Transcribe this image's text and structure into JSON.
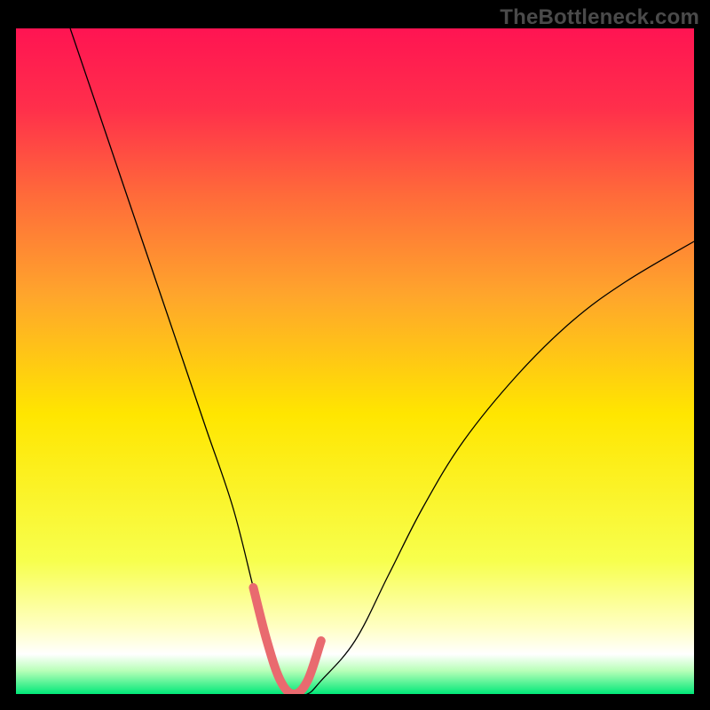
{
  "watermark": "TheBottleneck.com",
  "chart_data": {
    "type": "line",
    "title": "",
    "xlabel": "",
    "ylabel": "",
    "xlim": [
      0,
      100
    ],
    "ylim": [
      0,
      100
    ],
    "background_gradient": {
      "top_color": "#ff1452",
      "mid_color": "#ffe600",
      "bottom_color": "#00e878"
    },
    "series": [
      {
        "name": "bottleneck-curve",
        "x": [
          8,
          12,
          16,
          20,
          24,
          28,
          32,
          35,
          37,
          39,
          41,
          43,
          45,
          50,
          55,
          60,
          66,
          74,
          82,
          90,
          100
        ],
        "y": [
          100,
          88,
          76,
          64,
          52,
          40,
          28,
          16,
          8,
          2,
          0,
          0,
          2,
          8,
          18,
          28,
          38,
          48,
          56,
          62,
          68
        ],
        "stroke": "#000000",
        "stroke_width": 1.3
      },
      {
        "name": "optimal-zone-highlight",
        "x": [
          35,
          37,
          39,
          41,
          43,
          45
        ],
        "y": [
          16,
          8,
          2,
          0,
          2,
          8
        ],
        "stroke": "#e96a6f",
        "stroke_width": 10
      }
    ],
    "green_band": {
      "y_start": 0,
      "y_end": 4
    }
  }
}
